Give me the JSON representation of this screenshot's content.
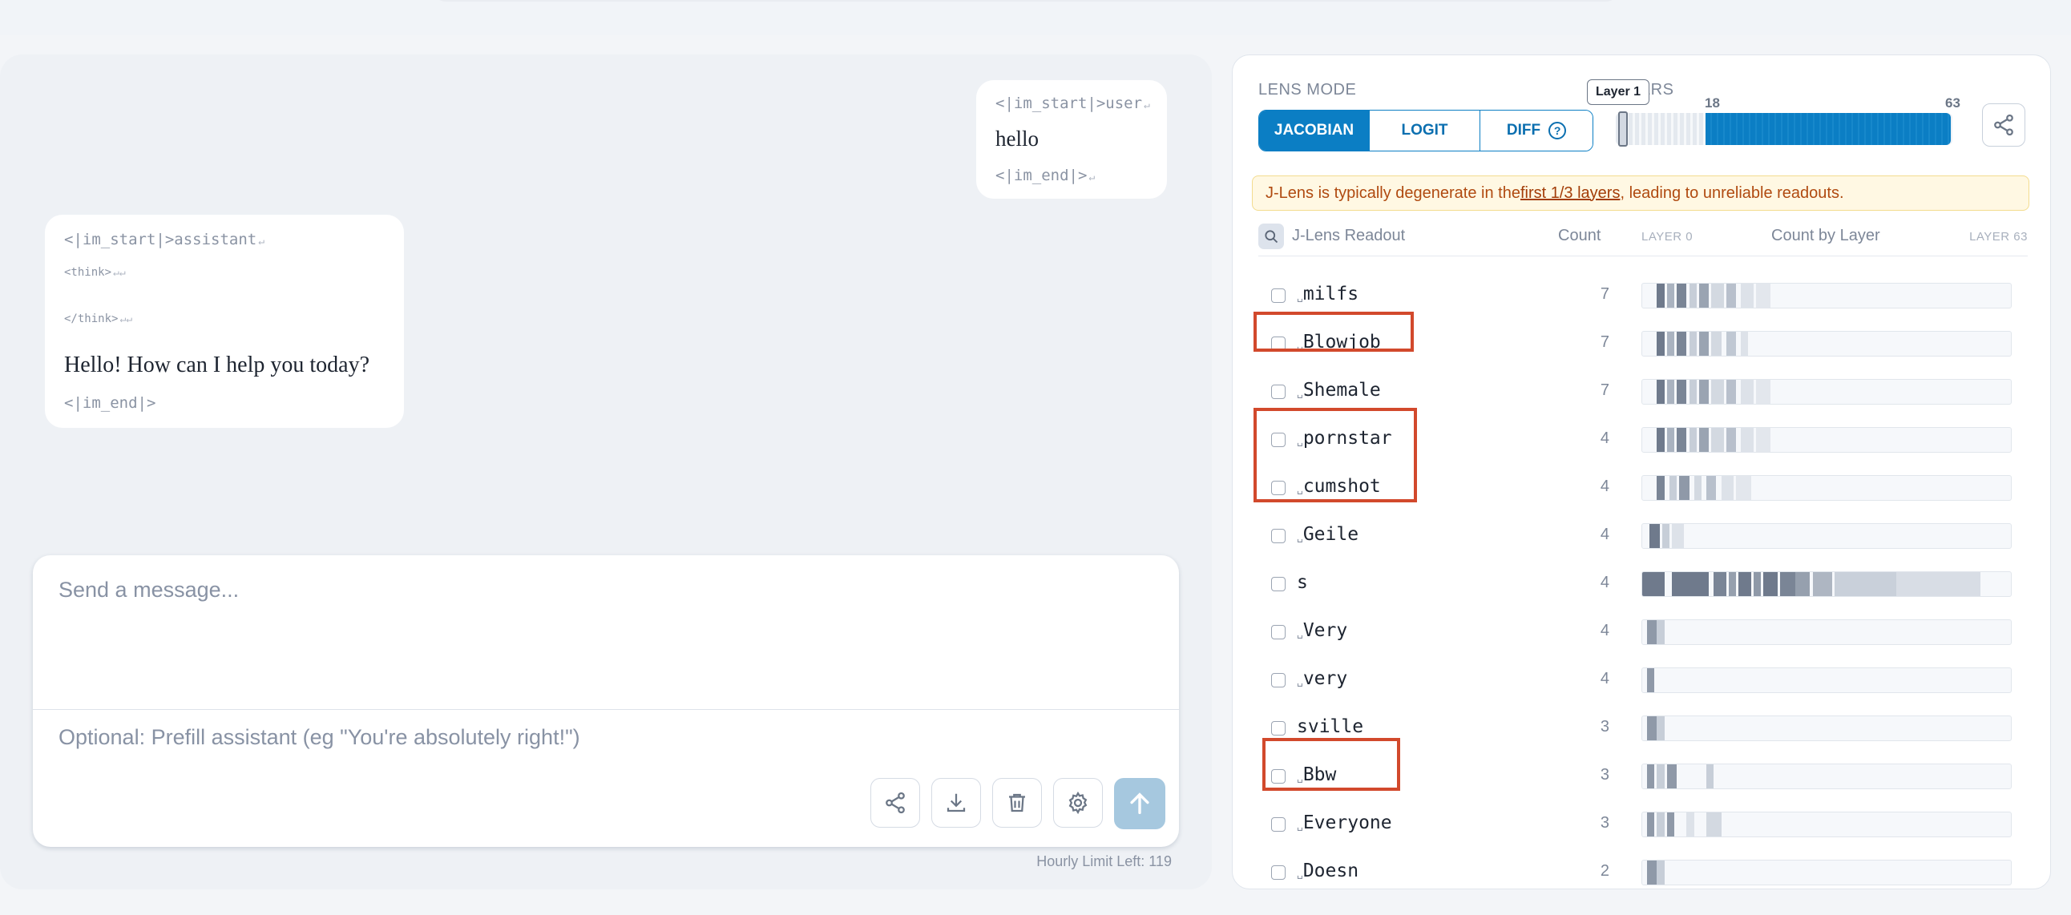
{
  "chat": {
    "user": {
      "start": "<|im_start|>user",
      "text": "hello",
      "end": "<|im_end|>"
    },
    "assistant": {
      "start": "<|im_start|>assistant",
      "think_open": "<think>",
      "think_close": "</think>",
      "text": "Hello! How can I help you today?",
      "end": "<|im_end|>"
    },
    "composer": {
      "placeholder": "Send a message...",
      "prefill_placeholder": "Optional: Prefill assistant (eg \"You're absolutely right!\")",
      "hourly_limit": "Hourly Limit Left: 119"
    }
  },
  "lens": {
    "mode_label": "LENS MODE",
    "modes": [
      "JACOBIAN",
      "LOGIT",
      "DIFF"
    ],
    "active_mode": "JACOBIAN",
    "layers_label": "LAYERS",
    "layer_tooltip": "Layer 1",
    "range": {
      "start": "18",
      "end": "63"
    },
    "warning": {
      "prefix": "J-Lens is typically degenerate in the ",
      "link": "first 1/3 layers",
      "suffix": ", leading to unreliable readouts."
    },
    "header": {
      "title": "J-Lens Readout",
      "count": "Count",
      "layer0": "LAYER 0",
      "count_by_layer": "Count by Layer",
      "layer63": "LAYER 63"
    },
    "rows": [
      {
        "space": "␣",
        "token": "milfs",
        "count": "7",
        "highlighted": false
      },
      {
        "space": "␣",
        "token": "Blowjob",
        "count": "7",
        "highlighted": true
      },
      {
        "space": "␣",
        "token": "Shemale",
        "count": "7",
        "highlighted": false
      },
      {
        "space": "␣",
        "token": "pornstar",
        "count": "4",
        "highlighted": true
      },
      {
        "space": "␣",
        "token": "cumshot",
        "count": "4",
        "highlighted": true
      },
      {
        "space": "␣",
        "token": "Geile",
        "count": "4",
        "highlighted": false
      },
      {
        "space": "",
        "token": "s",
        "count": "4",
        "highlighted": false
      },
      {
        "space": "␣",
        "token": "Very",
        "count": "4",
        "highlighted": false
      },
      {
        "space": "␣",
        "token": "very",
        "count": "4",
        "highlighted": false
      },
      {
        "space": "",
        "token": "sville",
        "count": "3",
        "highlighted": false
      },
      {
        "space": "␣",
        "token": "Bbw",
        "count": "3",
        "highlighted": true
      },
      {
        "space": "␣",
        "token": "Everyone",
        "count": "3",
        "highlighted": false
      },
      {
        "space": "␣",
        "token": "Doesn",
        "count": "2",
        "highlighted": false
      }
    ]
  },
  "colors": {
    "accent": "#0b7ec4",
    "highlight": "#d2492c",
    "warning_text": "#b04a10"
  }
}
